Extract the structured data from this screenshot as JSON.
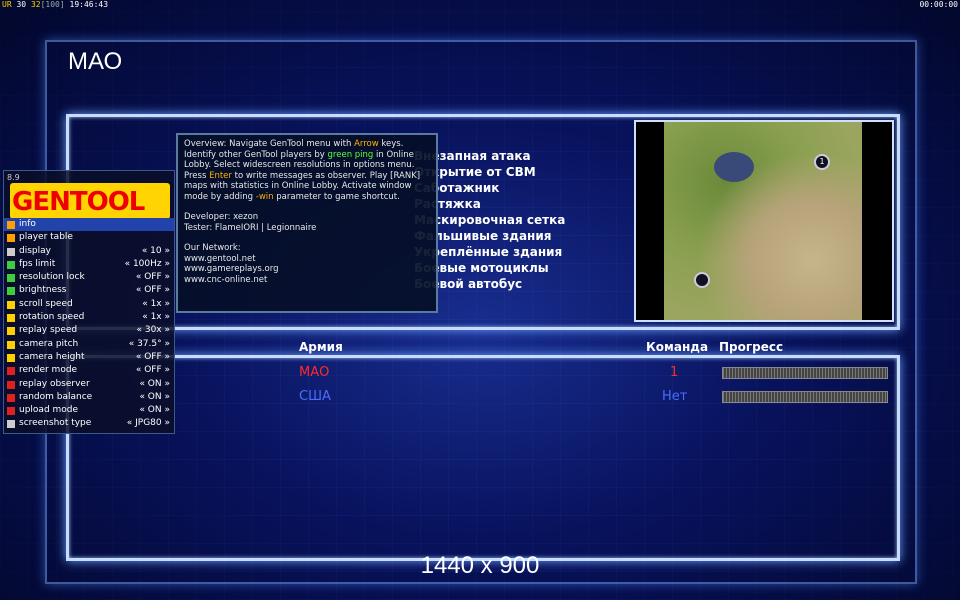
{
  "topbar": {
    "left_prefix": "UR",
    "left_a": "30",
    "left_b": "32",
    "left_c": "100",
    "left_time": "19:46:43",
    "right_time": "00:00:00"
  },
  "screen_title": "МАО",
  "options": [
    "Внезапная атака",
    "Открытие от СВМ",
    "Саботажник",
    "Растяжка",
    "Маскировочная сетка",
    "Фальшивые здания",
    "Укреплённые здания",
    "Боевые мотоциклы",
    "Боевой автобус"
  ],
  "table": {
    "headers": {
      "army": "Армия",
      "team": "Команда",
      "progress": "Прогресс"
    },
    "rows": [
      {
        "army": "МАО",
        "team": "1",
        "army_color": "#ff2a2a",
        "team_color": "#ff2a2a",
        "progress": 1.0
      },
      {
        "army": "США",
        "team": "Нет",
        "army_color": "#4a6cff",
        "team_color": "#4a6cff",
        "progress": 1.0
      }
    ]
  },
  "minimap": {
    "marker_a": "1"
  },
  "resolution": "1440 x 900",
  "gentool": {
    "version": "8.9",
    "logo_text": "GENTOOL",
    "items": [
      {
        "label": "info",
        "value": "",
        "color": "#ffa000"
      },
      {
        "label": "player table",
        "value": "",
        "color": "#ffa000"
      },
      {
        "label": "display",
        "value": "« 10 »",
        "color": "#cccccc"
      },
      {
        "label": "fps limit",
        "value": "« 100Hz »",
        "color": "#40cc40"
      },
      {
        "label": "resolution lock",
        "value": "« OFF »",
        "color": "#40cc40"
      },
      {
        "label": "brightness",
        "value": "« OFF »",
        "color": "#40cc40"
      },
      {
        "label": "scroll speed",
        "value": "« 1x »",
        "color": "#ffd000"
      },
      {
        "label": "rotation speed",
        "value": "« 1x »",
        "color": "#ffd000"
      },
      {
        "label": "replay speed",
        "value": "« 30x »",
        "color": "#ffd000"
      },
      {
        "label": "camera pitch",
        "value": "« 37.5° »",
        "color": "#ffd000"
      },
      {
        "label": "camera height",
        "value": "« OFF »",
        "color": "#ffd000"
      },
      {
        "label": "render mode",
        "value": "« OFF »",
        "color": "#dd2020"
      },
      {
        "label": "replay observer",
        "value": "« ON »",
        "color": "#dd2020"
      },
      {
        "label": "random balance",
        "value": "« ON »",
        "color": "#dd2020"
      },
      {
        "label": "upload mode",
        "value": "« ON »",
        "color": "#dd2020"
      },
      {
        "label": "screenshot type",
        "value": "« JPG80 »",
        "color": "#cccccc"
      }
    ]
  },
  "tooltip": {
    "overview_1": "Overview: Navigate GenTool menu with ",
    "arrow": "Arrow",
    "overview_2": " keys. Identify other GenTool players by ",
    "green_ping": "green ping",
    "overview_3": " in Online Lobby. Select widescreen resolutions in options menu. Press ",
    "enter": "Enter",
    "overview_4": " to write messages as observer. Play [RANK] maps with statistics in Online Lobby. Activate window mode by adding ",
    "win": "-win",
    "overview_5": " parameter to game shortcut.",
    "developer": "Developer: xezon",
    "tester": "Tester: FlameIORI | Legionnaire",
    "network_title": "Our Network:",
    "links": [
      "www.gentool.net",
      "www.gamereplays.org",
      "www.cnc-online.net"
    ]
  }
}
